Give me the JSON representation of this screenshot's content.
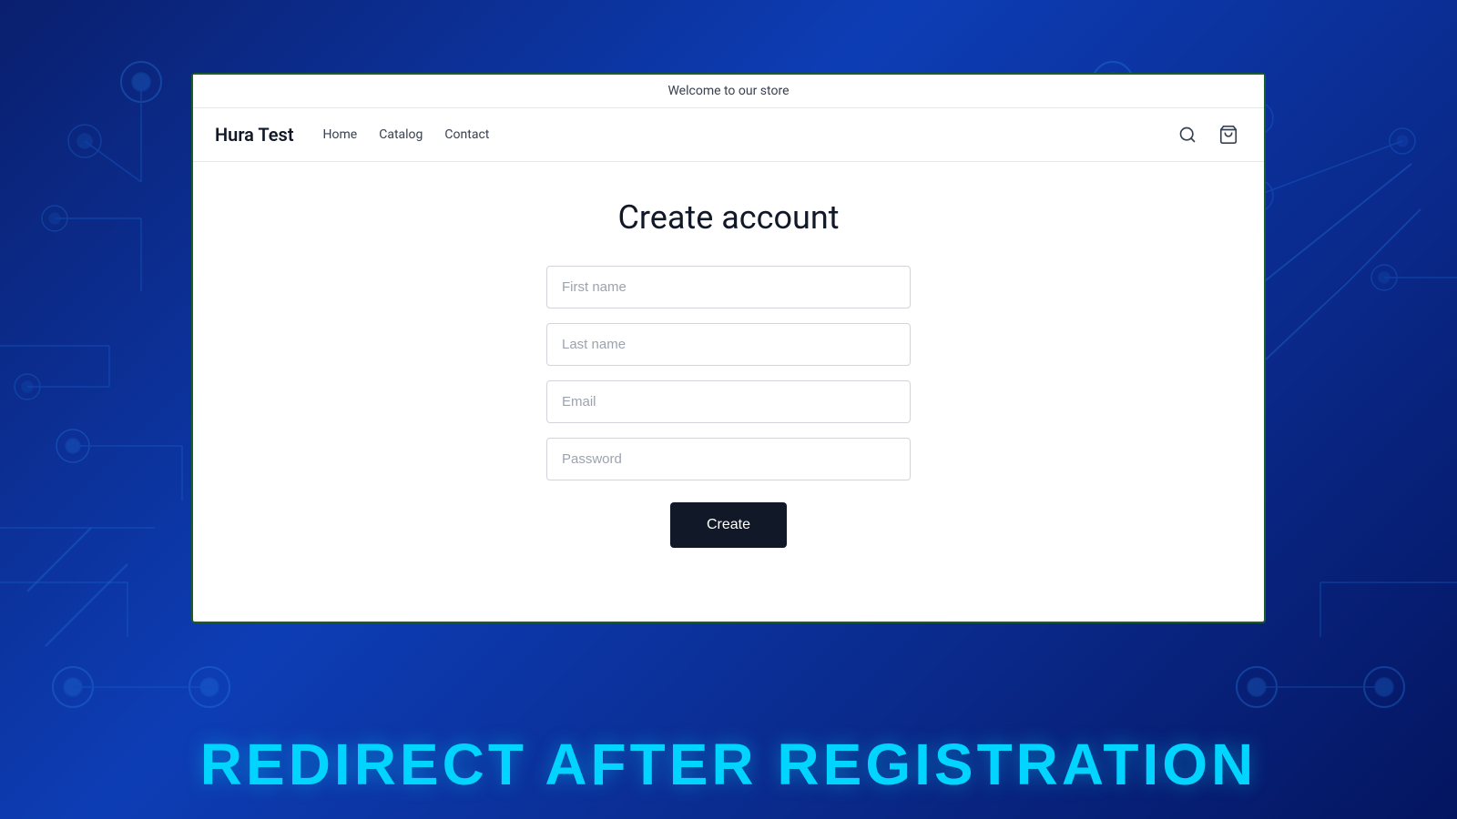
{
  "background": {
    "bottom_banner": "REDIRECT AFTER REGISTRATION"
  },
  "announcement": {
    "text": "Welcome to our store"
  },
  "nav": {
    "brand": "Hura Test",
    "links": [
      {
        "label": "Home"
      },
      {
        "label": "Catalog"
      },
      {
        "label": "Contact"
      }
    ]
  },
  "form": {
    "title": "Create account",
    "fields": {
      "first_name_placeholder": "First name",
      "last_name_placeholder": "Last name",
      "email_placeholder": "Email",
      "password_placeholder": "Password"
    },
    "submit_label": "Create"
  }
}
